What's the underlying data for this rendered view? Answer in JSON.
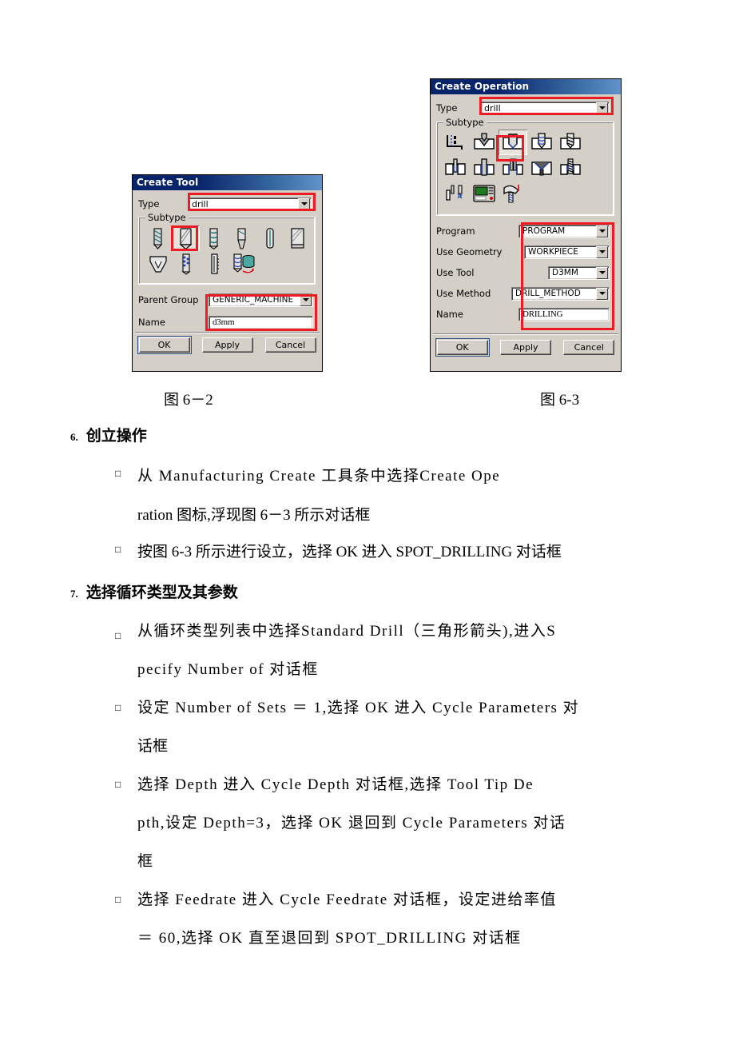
{
  "dialogs": {
    "create_tool": {
      "title": "Create Tool",
      "type_label": "Type",
      "type_value": "drill",
      "subtype_legend": "Subtype",
      "parent_group_label": "Parent Group",
      "parent_group_value": "GENERIC_MACHINE",
      "name_label": "Name",
      "name_value": "d3mm",
      "ok": "OK",
      "apply": "Apply",
      "cancel": "Cancel",
      "subtype_icons_row1": [
        "twist-drill-icon",
        "drill-selected-icon",
        "spiral-drill-icon",
        "step-drill-icon",
        "reamer-icon",
        "counterbore-icon"
      ],
      "subtype_icons_row2": [
        "countersink-icon",
        "tap-icon",
        "boring-bar-icon",
        "thread-mill-icon"
      ]
    },
    "create_operation": {
      "title": "Create Operation",
      "type_label": "Type",
      "type_value": "drill",
      "subtype_legend": "Subtype",
      "fields": [
        {
          "label": "Program",
          "value": "PROGRAM",
          "kind": "combo"
        },
        {
          "label": "Use Geometry",
          "value": "WORKPIECE",
          "kind": "combo"
        },
        {
          "label": "Use Tool",
          "value": "D3MM",
          "kind": "combo"
        },
        {
          "label": "Use Method",
          "value": "DRILL_METHOD",
          "kind": "combo"
        },
        {
          "label": "Name",
          "value": "DRILLING",
          "kind": "text"
        }
      ],
      "ok": "OK",
      "apply": "Apply",
      "cancel": "Cancel",
      "subtype_icons_row1": [
        "spot-face-icon",
        "spot-drilling-icon",
        "drilling-selected-icon",
        "peck-drilling-icon",
        "breakchip-drilling-icon",
        "boring-icon"
      ],
      "subtype_icons_row2": [
        "reaming-icon",
        "counterboring-icon",
        "countersinking-icon",
        "tapping-icon",
        "hole-milling-icon",
        "machine-control-icon"
      ],
      "subtype_icons_row3": [
        "user-defined-icon"
      ]
    }
  },
  "accent_colors": {
    "highlight_red": "#ed1c24",
    "title_blue": "#0a246a",
    "dialog_face": "#d4d0c8"
  },
  "captions": {
    "fig_left": "图 6－2",
    "fig_right": "图 6-3"
  },
  "sections": [
    {
      "number": "6.",
      "title": "创立操作",
      "bullets": [
        {
          "lines": [
            "从 Manufacturing  Create 工具条中选择Create  Ope",
            "ration 图标,浮现图 6－3 所示对话框"
          ]
        },
        {
          "lines": [
            "按图 6-3 所示进行设立，选择 OK 进入 SPOT_DRILLING 对话框"
          ]
        }
      ]
    },
    {
      "number": "7.",
      "title": "选择循环类型及其参数",
      "bullets": [
        {
          "lines": [
            "从循环类型列表中选择Standard  Drill（三角形箭头),进入S",
            "pecify Number of 对话框"
          ]
        },
        {
          "lines": [
            "设定 Number of Sets ＝ 1,选择 OK 进入 Cycle Parameters 对",
            "话框"
          ]
        },
        {
          "lines": [
            "选择 Depth 进入 Cycle  Depth 对话框,选择 Tool  Tip  De",
            "pth,设定 Depth=3，选择 OK 退回到 Cycle Parameters 对话",
            "框"
          ]
        },
        {
          "lines": [
            "选择 Feedrate 进入 Cycle Feedrate 对话框，设定进给率值",
            "＝ 60,选择 OK 直至退回到 SPOT_DRILLING 对话框"
          ]
        }
      ]
    }
  ]
}
